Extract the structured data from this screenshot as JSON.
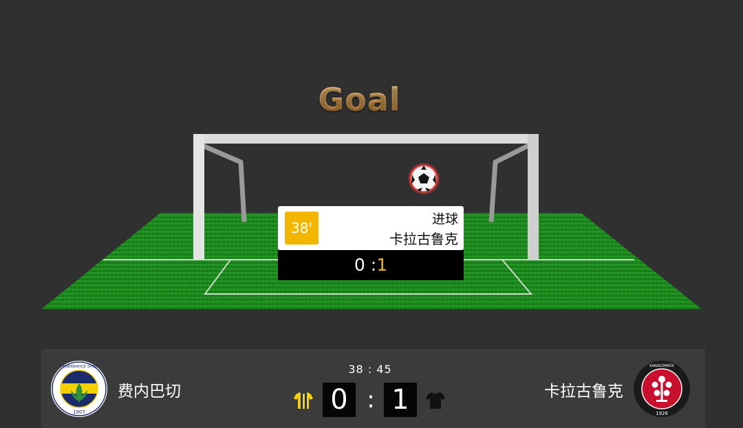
{
  "animation": {
    "title": "Goal",
    "event": {
      "minute": "38'",
      "type": "进球",
      "team": "卡拉古鲁克",
      "score_home": "0",
      "score_sep": " :",
      "score_away": "1"
    }
  },
  "scoreboard": {
    "clock": "38 : 45",
    "home_team": "费内巴切",
    "away_team": "卡拉古鲁克",
    "home_score": "0",
    "away_score": "1",
    "separator": ":",
    "home_logo_text": "FENERBAHÇE SPOR KULÜBÜ 1907",
    "away_logo_text": "FATİH KARAGÜMRÜK SPOR KULÜBÜ 1926"
  },
  "colors": {
    "background": "#303030",
    "pitch": "#1f8f1f",
    "accent": "#f2b600",
    "title_gold": "#d9983f"
  }
}
